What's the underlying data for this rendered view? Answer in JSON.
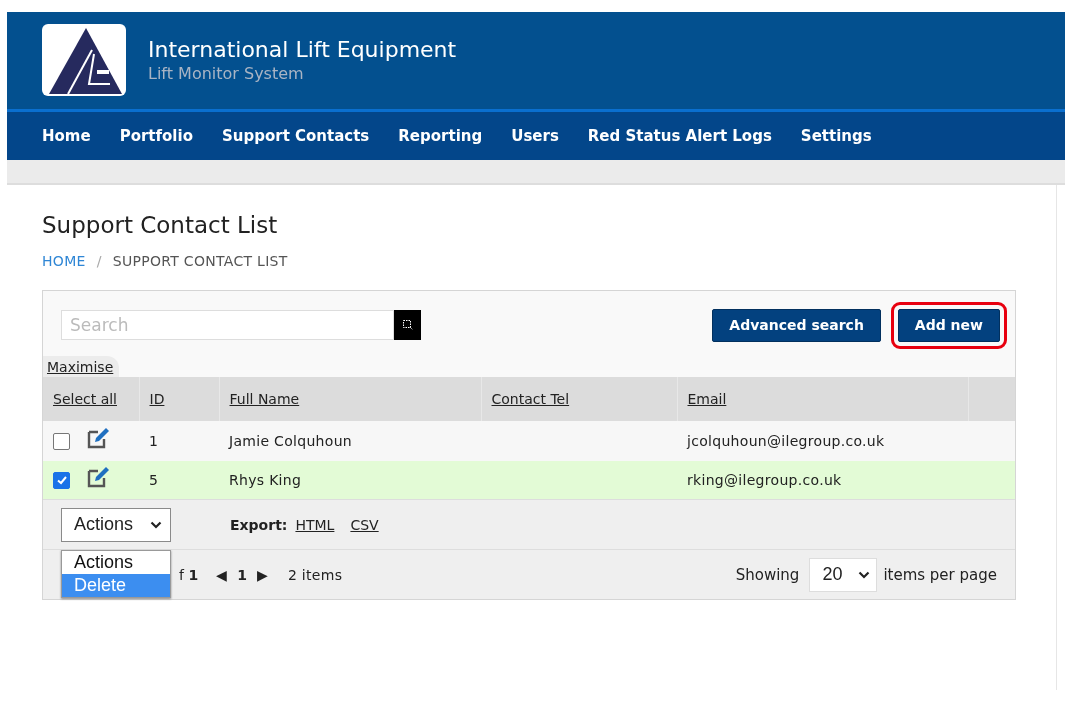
{
  "header": {
    "title": "International Lift Equipment",
    "subtitle": "Lift Monitor System"
  },
  "nav": [
    {
      "label": "Home"
    },
    {
      "label": "Portfolio"
    },
    {
      "label": "Support Contacts"
    },
    {
      "label": "Reporting"
    },
    {
      "label": "Users"
    },
    {
      "label": "Red Status Alert Logs"
    },
    {
      "label": "Settings"
    }
  ],
  "page_title": "Support Contact List",
  "breadcrumb": [
    {
      "label": "HOME",
      "kind": "link"
    },
    {
      "label": "/",
      "kind": "separator"
    },
    {
      "label": "SUPPORT CONTACT LIST",
      "kind": "current"
    }
  ],
  "search": {
    "placeholder": "Search"
  },
  "buttons": [
    {
      "label": "Advanced search",
      "highlighted": false
    },
    {
      "label": "Add new",
      "highlighted": true
    }
  ],
  "maximise_tab": "Maximise",
  "table": {
    "columns": [
      "Select all",
      "ID",
      "Full Name",
      "Contact Tel",
      "Email"
    ],
    "rows": [
      {
        "checked": false,
        "selected": false,
        "id": "1",
        "full_name": "Jamie Colquhoun",
        "email": "jcolquhoun@ilegroup.co.uk"
      },
      {
        "checked": true,
        "selected": true,
        "id": "5",
        "full_name": "Rhys King",
        "email": "rking@ilegroup.co.uk"
      }
    ]
  },
  "actions": {
    "value": "Actions",
    "expanded": true,
    "options": [
      {
        "label": "Actions",
        "highlighted": false
      },
      {
        "label": "Delete",
        "highlighted": true
      }
    ]
  },
  "export": {
    "label": "Export:",
    "links": [
      "HTML",
      "CSV"
    ]
  },
  "pager": {
    "page_info": "f **1**",
    "prev": "◀",
    "page": "1",
    "next": "▶",
    "items": "2 items",
    "showing": "Showing",
    "page_size": "20",
    "per_page": "items per page"
  }
}
